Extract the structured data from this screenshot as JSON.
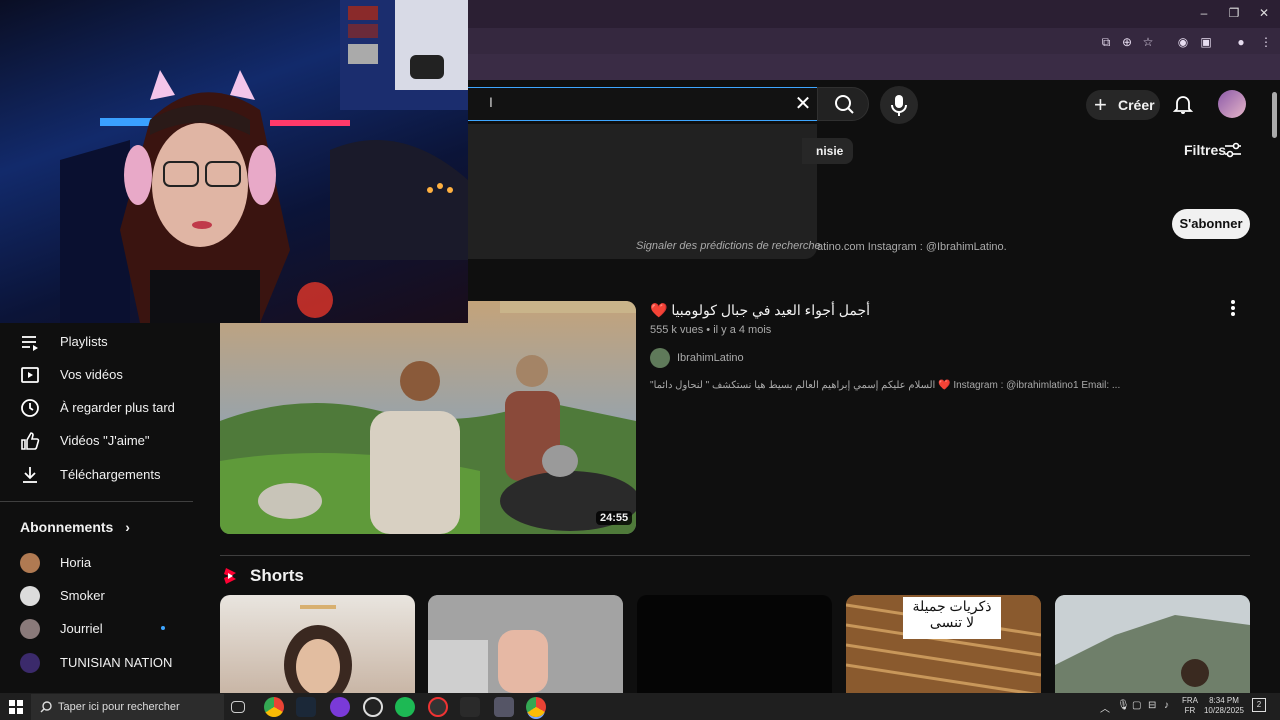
{
  "browser": {
    "window_controls": {
      "minimize": "–",
      "restore": "❐",
      "close": "✕"
    }
  },
  "header": {
    "search_value": "",
    "create_label": "Créer",
    "report_predictions": "Signaler des prédictions de recherche"
  },
  "filters_bar": {
    "chip_partial": "nisie",
    "filters_label": "Filtres"
  },
  "channel_result": {
    "description": "atino.com Instagram : @IbrahimLatino.",
    "subscribe_label": "S'abonner"
  },
  "sidebar": {
    "items": [
      {
        "label": "Playlists",
        "icon": "playlist-icon"
      },
      {
        "label": "Vos vidéos",
        "icon": "play-square-icon"
      },
      {
        "label": "À regarder plus tard",
        "icon": "clock-icon"
      },
      {
        "label": "Vidéos \"J'aime\"",
        "icon": "thumbs-up-icon"
      },
      {
        "label": "Téléchargements",
        "icon": "download-icon"
      }
    ],
    "subscriptions_title": "Abonnements",
    "subscriptions": [
      {
        "label": "Horia",
        "color": "#b07a52"
      },
      {
        "label": "Smoker",
        "color": "#dcdcdc"
      },
      {
        "label": "Jourriel",
        "color": "#8a7a7a",
        "new_dot": true
      },
      {
        "label": "TUNISIAN NATION",
        "color": "#3b2a6b"
      }
    ]
  },
  "video": {
    "title": "أجمل أجواء العيد في جبال كولومبيا ❤️",
    "views": "555 k vues",
    "age": "il y a 4 mois",
    "channel": "IbrahimLatino",
    "description": "\"السلام عليكم إسمي إبراهيم العالم بسيط هيا نستكشف \" لنحاول دائما ❤️ Instagram : @ibrahimlatino1 Email: ...",
    "duration": "24:55"
  },
  "shorts": {
    "title": "Shorts",
    "overlay_text": "ذكريات جميلة\nلا تنسى"
  },
  "taskbar": {
    "search_placeholder": "Taper ici pour rechercher",
    "lang_top": "FRA",
    "lang_bottom": "FR",
    "time": "8:34 PM",
    "date": "10/28/2025",
    "notification_count": "2"
  },
  "colors": {
    "page_bg": "#0f0f0f",
    "accent_blue": "#3ea6ff",
    "youtube_red": "#ff0033"
  }
}
